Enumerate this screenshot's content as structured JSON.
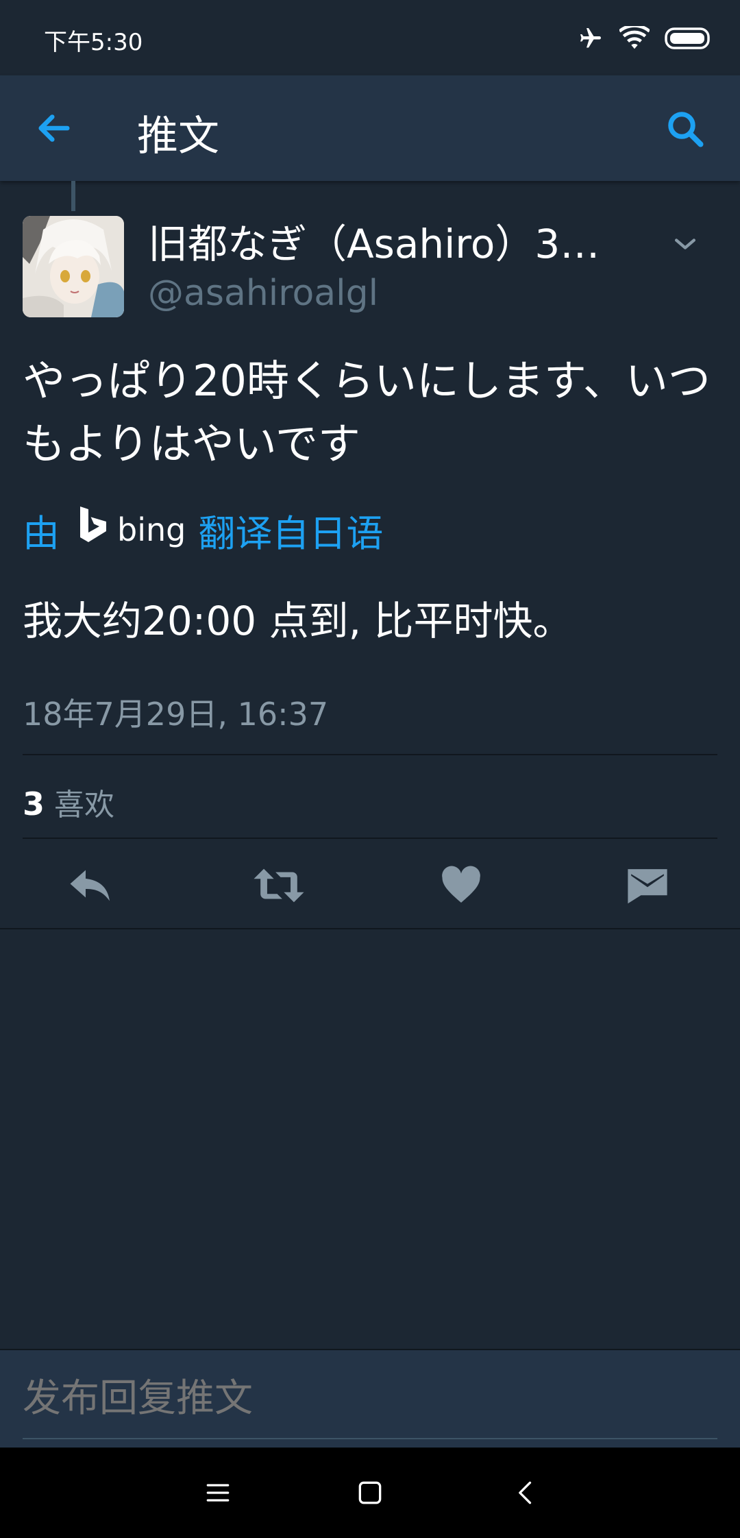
{
  "status_bar": {
    "time": "下午5:30",
    "icons": [
      "airplane-icon",
      "wifi-icon",
      "battery-icon"
    ]
  },
  "app_bar": {
    "title": "推文",
    "back_icon": "arrow-left-icon",
    "search_icon": "search-icon"
  },
  "tweet": {
    "display_name": "旧都なぎ（Asahiro）3日…",
    "handle": "@asahiroalgl",
    "text": "やっぱり20時くらいにします、いつもよりはやいです",
    "translate_prefix": "由",
    "translate_brand": "bing",
    "translate_suffix": "翻译自日语",
    "translated_text": "我大约20:00 点到, 比平时快。",
    "timestamp": "18年7月29日, 16:37",
    "likes_count": "3",
    "likes_label": "喜欢"
  },
  "actions": [
    "reply-icon",
    "retweet-icon",
    "heart-icon",
    "message-icon"
  ],
  "reply": {
    "placeholder": "发布回复推文"
  },
  "colors": {
    "background": "#1c2733",
    "app_bar": "#243447",
    "accent": "#1da1f2",
    "secondary_text": "#8899a6",
    "action_icon": "#8899a6"
  }
}
